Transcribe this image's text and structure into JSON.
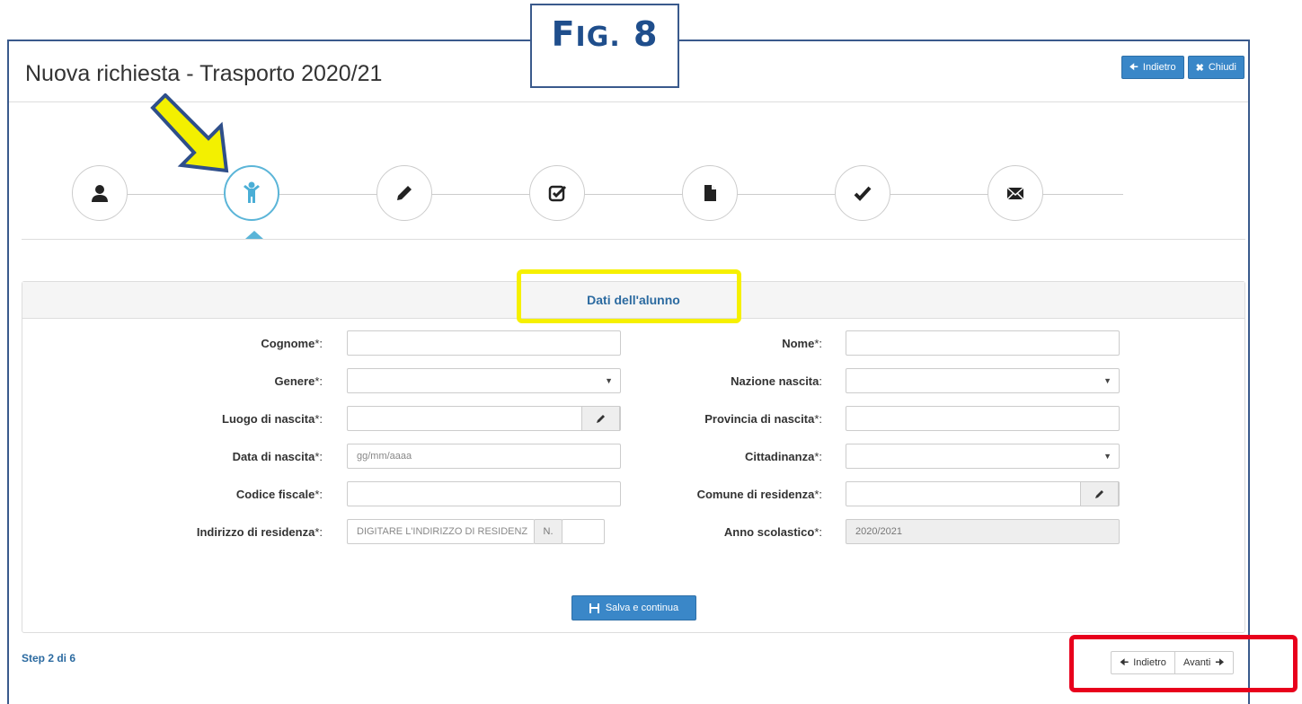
{
  "figure_label": {
    "prefix": "F",
    "rest": "IG.",
    "number": "8"
  },
  "header": {
    "title": "Nuova richiesta - Trasporto 2020/21",
    "back_label": "Indietro",
    "close_label": "Chiudi"
  },
  "stepper": {
    "steps": [
      {
        "icon": "user-icon"
      },
      {
        "icon": "child-icon",
        "active": true
      },
      {
        "icon": "pencil-icon"
      },
      {
        "icon": "check-square-icon"
      },
      {
        "icon": "file-icon"
      },
      {
        "icon": "checkmark-icon"
      },
      {
        "icon": "envelope-icon"
      }
    ]
  },
  "panel": {
    "title": "Dati dell'alunno",
    "left": [
      {
        "label": "Cognome",
        "star": "*:",
        "value": ""
      },
      {
        "label": "Genere",
        "star": "*:",
        "value": ""
      },
      {
        "label": "Luogo di nascita",
        "star": "*:",
        "value": ""
      },
      {
        "label": "Data di nascita",
        "star": "*:",
        "placeholder": "gg/mm/aaaa"
      },
      {
        "label": "Codice fiscale",
        "star": "*:",
        "value": ""
      },
      {
        "label": "Indirizzo di residenza",
        "star": "*:",
        "placeholder": "DIGITARE L'INDIRIZZO DI RESIDENZ",
        "number_label": "N."
      }
    ],
    "right": [
      {
        "label": "Nome",
        "star": "*:",
        "value": ""
      },
      {
        "label": "Nazione nascita",
        "star": ":",
        "value": ""
      },
      {
        "label": "Provincia di nascita",
        "star": "*:",
        "value": ""
      },
      {
        "label": "Cittadinanza",
        "star": "*:",
        "value": ""
      },
      {
        "label": "Comune di residenza",
        "star": "*:",
        "value": ""
      },
      {
        "label": "Anno scolastico",
        "star": "*:",
        "value": "2020/2021"
      }
    ],
    "save_label": "Salva e continua"
  },
  "footer": {
    "step_info": "Step 2 di 6",
    "back_label": "Indietro",
    "next_label": "Avanti"
  }
}
